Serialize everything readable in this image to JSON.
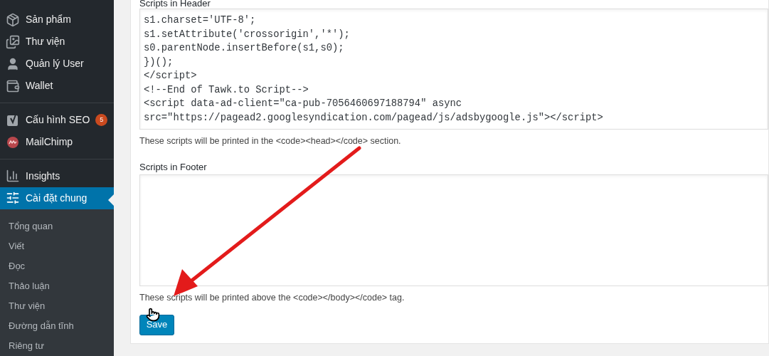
{
  "sidebar": {
    "items": [
      {
        "label": "Sản phẩm",
        "selected": false
      },
      {
        "label": "Thư viện",
        "selected": false
      },
      {
        "label": "Quản lý User",
        "selected": false
      },
      {
        "label": "Wallet",
        "selected": false,
        "separator_after": true
      },
      {
        "label": "Cấu hình SEO",
        "selected": false,
        "badge": "5"
      },
      {
        "label": "MailChimp",
        "selected": false,
        "separator_after": true
      },
      {
        "label": "Insights",
        "selected": false
      },
      {
        "label": "Cài đặt chung",
        "selected": true
      }
    ],
    "submenu": [
      "Tổng quan",
      "Viết",
      "Đọc",
      "Thảo luận",
      "Thư viện",
      "Đường dẫn tĩnh",
      "Riêng tư"
    ]
  },
  "header_scripts": {
    "label": "Scripts in Header",
    "lines": [
      "s1.charset='UTF-8';",
      "s1.setAttribute('crossorigin','*');",
      "s0.parentNode.insertBefore(s1,s0);",
      "})();",
      "</script>",
      "<!--End of Tawk.to Script-->",
      "<script data-ad-client=\"ca-pub-7056460697188794\" async",
      "src=\"https://pagead2.googlesyndication.com/pagead/js/adsbygoogle.js\"></script>"
    ],
    "help": "These scripts will be printed in the <code><head></code> section."
  },
  "footer_scripts": {
    "label": "Scripts in Footer",
    "help": "These scripts will be printed above the <code></body></code> tag."
  },
  "save_button": "Save"
}
